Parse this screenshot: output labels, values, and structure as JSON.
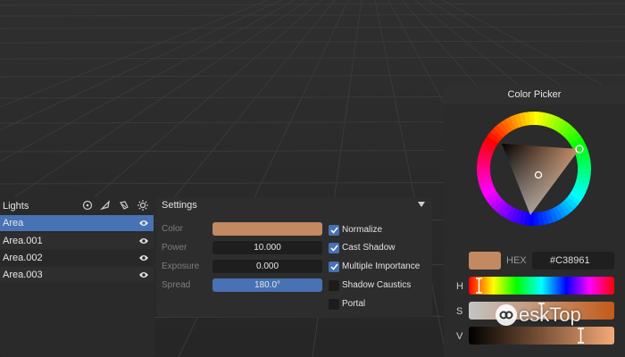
{
  "lights": {
    "header": "Lights",
    "header_icons": [
      "target-icon",
      "leaf-icon",
      "brush-icon",
      "sun-icon"
    ],
    "items": [
      {
        "name": "Area",
        "selected": true
      },
      {
        "name": "Area.001",
        "selected": false
      },
      {
        "name": "Area.002",
        "selected": false
      },
      {
        "name": "Area.003",
        "selected": false
      }
    ]
  },
  "settings": {
    "title": "Settings",
    "color_label": "Color",
    "color_value": "#c38961",
    "power_label": "Power",
    "power_value": "10.000",
    "exposure_label": "Exposure",
    "exposure_value": "0.000",
    "spread_label": "Spread",
    "spread_value": "180.0°",
    "checks": [
      {
        "label": "Normalize",
        "checked": true
      },
      {
        "label": "Cast Shadow",
        "checked": true
      },
      {
        "label": "Multiple Importance",
        "checked": true
      },
      {
        "label": "Shadow Caustics",
        "checked": false
      },
      {
        "label": "Portal",
        "checked": false
      }
    ]
  },
  "color_picker": {
    "title": "Color Picker",
    "hex_label": "HEX",
    "hex_value": "#C38961",
    "swatch_color": "#c38961",
    "h_label": "H",
    "s_label": "S",
    "v_label": "V",
    "h_level": 0.07,
    "s_level": 0.5,
    "v_level": 0.77
  },
  "watermark": {
    "text": "eskTop"
  },
  "colors": {
    "accent": "#4772b3",
    "panel": "#2b2b2b",
    "field": "#1e1e1e"
  }
}
